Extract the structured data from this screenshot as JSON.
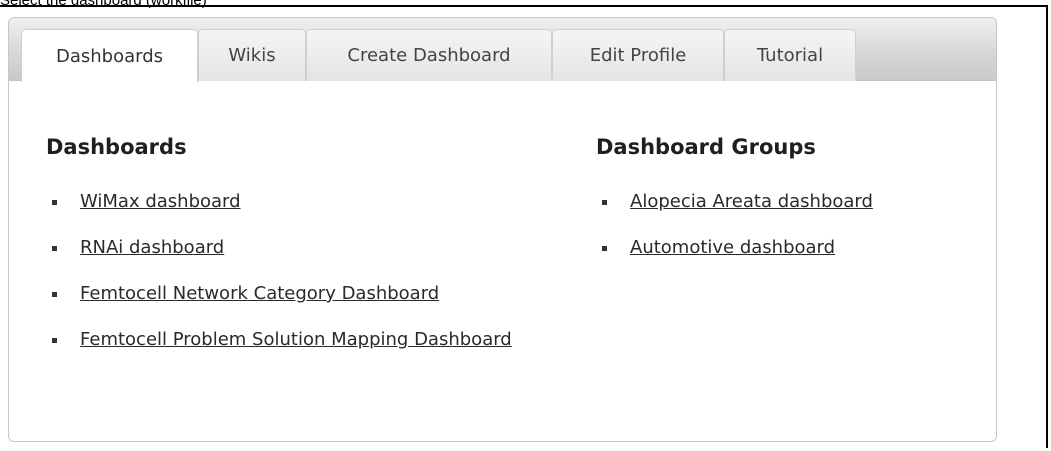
{
  "caption": "Select the dashboard (workflle)",
  "tabs": [
    {
      "label": "Dashboards",
      "active": true
    },
    {
      "label": "Wikis",
      "active": false
    },
    {
      "label": "Create Dashboard",
      "active": false
    },
    {
      "label": "Edit Profile",
      "active": false
    },
    {
      "label": "Tutorial",
      "active": false
    }
  ],
  "dashboards": {
    "title": "Dashboards",
    "items": [
      "WiMax dashboard",
      "RNAi dashboard",
      "Femtocell Network Category Dashboard",
      "Femtocell Problem Solution Mapping Dashboard"
    ]
  },
  "groups": {
    "title": "Dashboard Groups",
    "items": [
      "Alopecia Areata dashboard",
      "Automotive dashboard"
    ]
  }
}
